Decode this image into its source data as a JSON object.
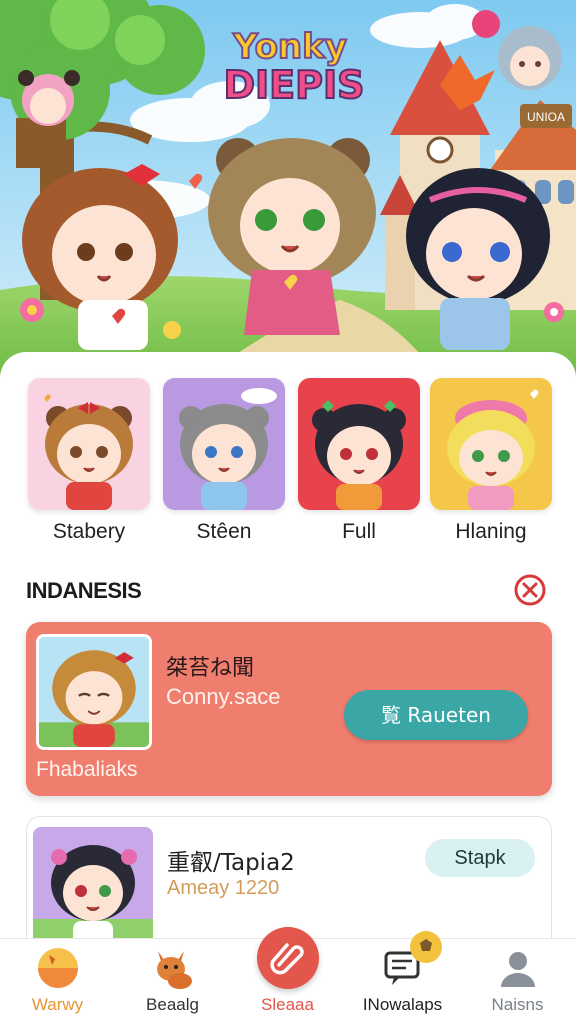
{
  "hero": {
    "logo_line1": "Yonky",
    "logo_line2": "DIEPIS",
    "sign_text": "UNIOA"
  },
  "characters": [
    {
      "name": "Stabery",
      "bg": "#f9d3e2",
      "hair": "#b97a3a",
      "eyes": "#7a4a2a",
      "shirt": "#e0463f"
    },
    {
      "name": "Stêen",
      "bg": "#b99ae2",
      "hair": "#8b8b8b",
      "eyes": "#3a78c5",
      "shirt": "#8ec5ec"
    },
    {
      "name": "Full",
      "bg": "#e8424d",
      "hair": "#2a2a36",
      "eyes": "#c0303a",
      "shirt": "#f09a3a"
    },
    {
      "name": "Hlaning",
      "bg": "#f4c64a",
      "hair": "#f2de5a",
      "eyes": "#3f9a4a",
      "shirt": "#f29ac2"
    }
  ],
  "section": {
    "title": "INDANESIS",
    "close_icon": "close-circle-icon"
  },
  "featured": {
    "title": "桀苔ね聞",
    "subtitle": "Conny.sace",
    "footer_label": "Fhabaliaks",
    "action_label": "覧 Raueten",
    "bg": "#f07e6e",
    "action_bg": "#3aa7a6"
  },
  "item": {
    "title": "重叡/Tapia2",
    "subtitle": "Ameay 1220",
    "pill_label": "Stapk"
  },
  "nav": [
    {
      "label": "Warwy",
      "icon": "sunset-orb-icon",
      "color": "#e89433"
    },
    {
      "label": "Beaalg",
      "icon": "fox-icon",
      "color": "#333333"
    },
    {
      "label": "Sleaaa",
      "icon": "paperclip-icon",
      "color": "#e2564b"
    },
    {
      "label": "INowalaps",
      "icon": "chat-bubble-icon",
      "color": "#222222"
    },
    {
      "label": "Naisns",
      "icon": "profile-icon",
      "color": "#7a8088"
    }
  ]
}
